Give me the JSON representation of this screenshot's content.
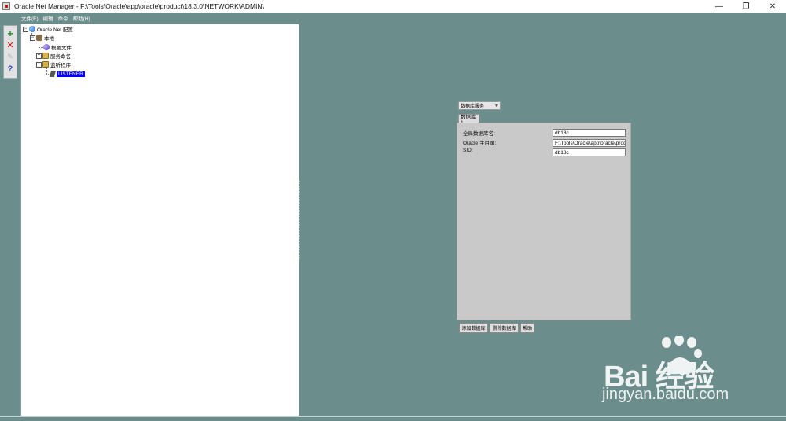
{
  "window": {
    "title": "Oracle Net Manager - F:\\Tools\\Oracle\\app\\oracle\\product\\18.3.0\\NETWORK\\ADMIN\\",
    "controls": {
      "minimize": "—",
      "restore": "❐",
      "close": "✕"
    }
  },
  "menubar": [
    "文件(E)",
    "编辑",
    "命令",
    "帮助(H)"
  ],
  "toolbar": {
    "add_icon": "plus-icon",
    "delete_icon": "x-icon",
    "rename_icon": "rename-icon",
    "help_icon": "question-icon"
  },
  "tree": {
    "root": "Oracle Net 配置",
    "local": "本地",
    "profile": "概要文件",
    "service_naming": "服务命名",
    "listeners": "监听程序",
    "listener": "LISTENER"
  },
  "detail": {
    "dropdown_value": "数据库服务",
    "tab_label": "数据库1",
    "fields": {
      "global_db_name_label": "全局数据库名:",
      "global_db_name_value": "db18c",
      "oracle_home_label": "Oracle 主目录:",
      "oracle_home_value": "F:\\Tools\\Oracle\\app\\oracle\\produ",
      "sid_label": "SID:",
      "sid_value": "db18c"
    },
    "buttons": {
      "add_db": "添加数据库",
      "delete_db": "删除数据库",
      "help": "帮助"
    }
  },
  "watermark": {
    "brand": "Bai  经验",
    "url": "jingyan.baidu.com"
  },
  "colors": {
    "background": "#6b8d8b",
    "selection": "#0000ff",
    "panel": "#c9c9c9"
  }
}
